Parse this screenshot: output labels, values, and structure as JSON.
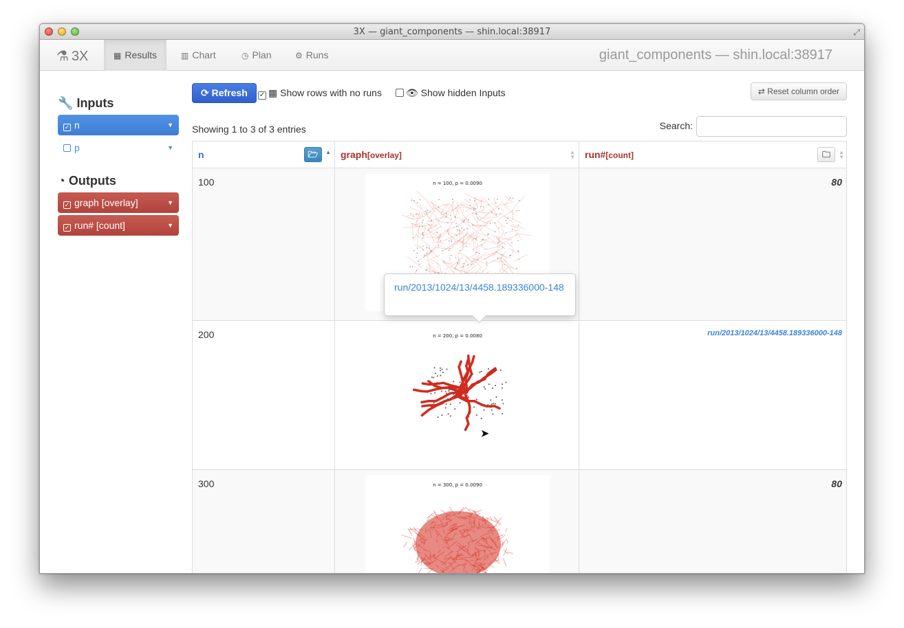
{
  "window": {
    "title": "3X — giant_components — shin.local:38917"
  },
  "nav": {
    "brand": "3X",
    "items": [
      {
        "label": "Results",
        "icon": "table-icon"
      },
      {
        "label": "Chart",
        "icon": "bar-chart-icon"
      },
      {
        "label": "Plan",
        "icon": "dashboard-icon"
      },
      {
        "label": "Runs",
        "icon": "cogs-icon"
      }
    ],
    "right_title": "giant_components — shin.local:38917"
  },
  "sidebar": {
    "inputs_heading": "Inputs",
    "inputs": [
      {
        "label": "n",
        "checked": true
      },
      {
        "label": "p",
        "checked": false
      }
    ],
    "outputs_heading": "Outputs",
    "outputs": [
      {
        "label": "graph [overlay]",
        "checked": true
      },
      {
        "label": "run# [count]",
        "checked": true
      }
    ]
  },
  "toolbar": {
    "refresh_label": "Refresh",
    "show_no_runs_label": "Show rows with no runs",
    "show_no_runs_checked": true,
    "show_hidden_label": "Show hidden Inputs",
    "show_hidden_checked": false,
    "reset_label": "Reset column order"
  },
  "table_info": {
    "showing": "Showing 1 to 3 of 3 entries",
    "search_label": "Search:",
    "search_value": ""
  },
  "table": {
    "columns": [
      {
        "name": "n",
        "sub": ""
      },
      {
        "name": "graph",
        "sub": "[overlay]"
      },
      {
        "name": "run#",
        "sub": "[count]"
      }
    ],
    "rows": [
      {
        "n": "100",
        "plot_title": "n = 100, p = 0.0090",
        "run": "80"
      },
      {
        "n": "200",
        "plot_title": "n = 200, p = 0.0080",
        "run": "run/2013/1024/13/4458.189336000-148"
      },
      {
        "n": "300",
        "plot_title": "n = 300, p = 0.0090",
        "run": "80"
      }
    ]
  },
  "popover": {
    "text": "run/2013/1024/13/4458.189336000-148"
  },
  "colors": {
    "blue": "#4a89dc",
    "red": "#b0443d",
    "link": "#3a84d4",
    "plot_red": "#d42a1e"
  }
}
